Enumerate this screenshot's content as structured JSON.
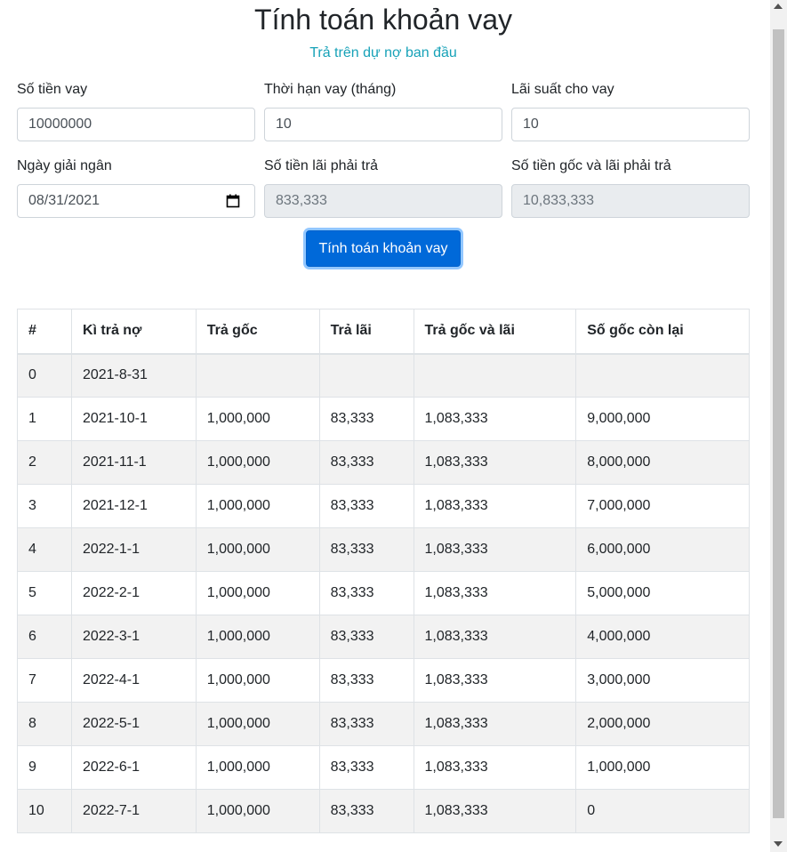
{
  "header": {
    "title": "Tính toán khoản vay",
    "subtitle": "Trả trên dự nợ ban đầu"
  },
  "form": {
    "loan_amount": {
      "label": "Số tiền vay",
      "value": "10000000"
    },
    "term": {
      "label": "Thời hạn vay (tháng)",
      "value": "10"
    },
    "interest_rate": {
      "label": "Lãi suất cho vay",
      "value": "10"
    },
    "disbursement_date": {
      "label": "Ngày giải ngân",
      "value": "08/31/2021"
    },
    "total_interest": {
      "label": "Số tiền lãi phải trả",
      "value": "833,333"
    },
    "total_payment": {
      "label": "Số tiền gốc và lãi phải trả",
      "value": "10,833,333"
    }
  },
  "calculate_button": {
    "label": "Tính toán khoản vay"
  },
  "table": {
    "headers": [
      "#",
      "Kì trả nợ",
      "Trả gốc",
      "Trả lãi",
      "Trả gốc và lãi",
      "Số gốc còn lại"
    ],
    "rows": [
      [
        "0",
        "2021-8-31",
        "",
        "",
        "",
        ""
      ],
      [
        "1",
        "2021-10-1",
        "1,000,000",
        "83,333",
        "1,083,333",
        "9,000,000"
      ],
      [
        "2",
        "2021-11-1",
        "1,000,000",
        "83,333",
        "1,083,333",
        "8,000,000"
      ],
      [
        "3",
        "2021-12-1",
        "1,000,000",
        "83,333",
        "1,083,333",
        "7,000,000"
      ],
      [
        "4",
        "2022-1-1",
        "1,000,000",
        "83,333",
        "1,083,333",
        "6,000,000"
      ],
      [
        "5",
        "2022-2-1",
        "1,000,000",
        "83,333",
        "1,083,333",
        "5,000,000"
      ],
      [
        "6",
        "2022-3-1",
        "1,000,000",
        "83,333",
        "1,083,333",
        "4,000,000"
      ],
      [
        "7",
        "2022-4-1",
        "1,000,000",
        "83,333",
        "1,083,333",
        "3,000,000"
      ],
      [
        "8",
        "2022-5-1",
        "1,000,000",
        "83,333",
        "1,083,333",
        "2,000,000"
      ],
      [
        "9",
        "2022-6-1",
        "1,000,000",
        "83,333",
        "1,083,333",
        "1,000,000"
      ],
      [
        "10",
        "2022-7-1",
        "1,000,000",
        "83,333",
        "1,083,333",
        "0"
      ]
    ]
  },
  "colors": {
    "subtitle": "#17a2b8",
    "primary_button": "#0069d9",
    "striped_row": "#f2f2f2",
    "readonly_input": "#e9ecef"
  },
  "icons": {
    "date_picker": "calendar-icon"
  }
}
